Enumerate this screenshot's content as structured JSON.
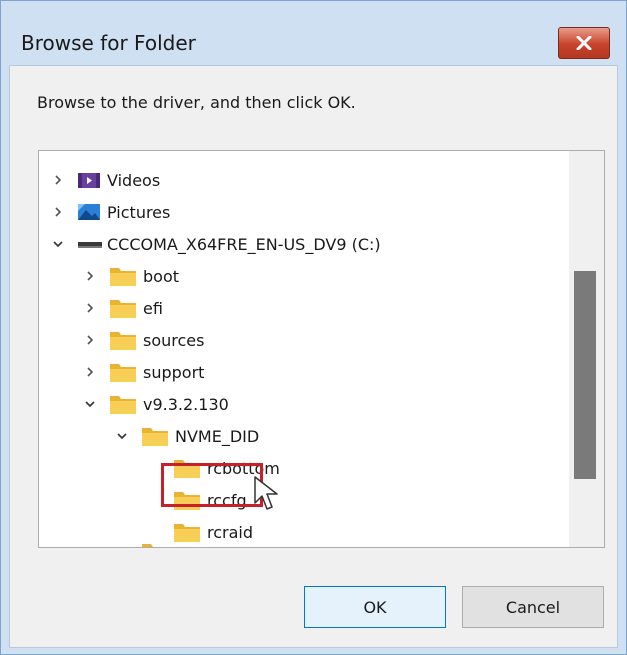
{
  "window": {
    "title": "Browse for Folder"
  },
  "instruction": "Browse to the driver, and then click OK.",
  "tree": {
    "items": [
      {
        "label": "Videos",
        "icon": "videos-icon",
        "expander": "collapsed"
      },
      {
        "label": "Pictures",
        "icon": "pictures-icon",
        "expander": "collapsed"
      },
      {
        "label": "CCCOMA_X64FRE_EN-US_DV9 (C:)",
        "icon": "drive-icon",
        "expander": "expanded"
      },
      {
        "label": "boot",
        "icon": "folder-icon",
        "expander": "collapsed"
      },
      {
        "label": "efi",
        "icon": "folder-icon",
        "expander": "collapsed"
      },
      {
        "label": "sources",
        "icon": "folder-icon",
        "expander": "collapsed"
      },
      {
        "label": "support",
        "icon": "folder-icon",
        "expander": "collapsed"
      },
      {
        "label": "v9.3.2.130",
        "icon": "folder-icon",
        "expander": "expanded"
      },
      {
        "label": "NVME_DID",
        "icon": "folder-icon",
        "expander": "expanded"
      },
      {
        "label": "rcbottom",
        "icon": "folder-icon",
        "expander": "none"
      },
      {
        "label": "rccfg",
        "icon": "folder-icon",
        "expander": "none",
        "selected": true
      },
      {
        "label": "rcraid",
        "icon": "folder-icon",
        "expander": "none"
      }
    ]
  },
  "buttons": {
    "ok": "OK",
    "cancel": "Cancel"
  },
  "colors": {
    "highlight": "#c8202b",
    "folder": "#f5c542",
    "titlebar": "#cfe0f2"
  }
}
